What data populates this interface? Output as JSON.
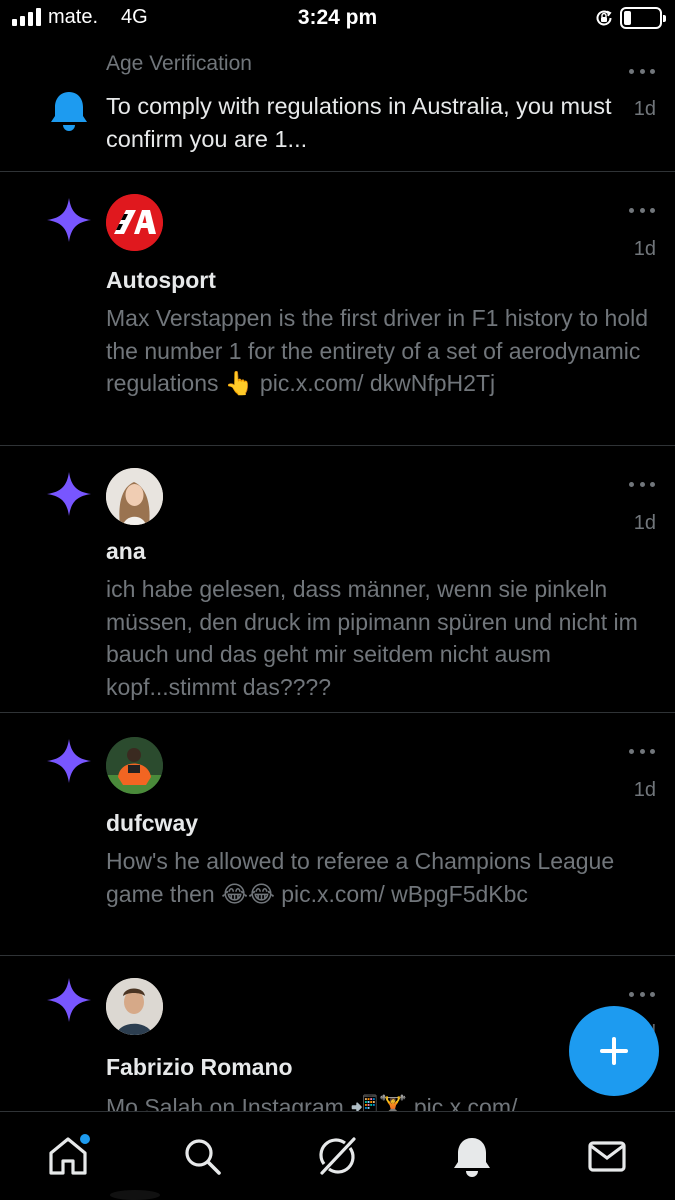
{
  "status_bar": {
    "carrier": "mate.",
    "network": "4G",
    "time": "3:24 pm",
    "battery_level": 0.2
  },
  "notifications": [
    {
      "type": "system",
      "label": "Age Verification",
      "text": "To comply with regulations in Australia, you must confirm you are 1...",
      "time": "1d",
      "icon": "bell-icon"
    },
    {
      "type": "recommended",
      "name": "Autosport",
      "text": "Max Verstappen is the first driver in F1 history to hold the number 1 for the entirety of a set of aerodynamic regulations 👆 pic.x.com/ dkwNfpH2Tj",
      "time": "1d",
      "icon": "sparkle-icon"
    },
    {
      "type": "recommended",
      "name": "ana",
      "text": "ich habe gelesen, dass männer, wenn sie pinkeln müssen, den druck im pipimann spüren und nicht im bauch und das geht mir seitdem nicht ausm kopf...stimmt das????",
      "time": "1d",
      "icon": "sparkle-icon"
    },
    {
      "type": "recommended",
      "name": "dufcway",
      "text": "How's he allowed to referee a Champions League game then 😂😂 pic.x.com/ wBpgF5dKbc",
      "time": "1d",
      "icon": "sparkle-icon"
    },
    {
      "type": "recommended",
      "name": "Fabrizio Romano",
      "text": "Mo Salah on Instagram 📲🏋️ pic.x.com/",
      "time": "1d",
      "icon": "sparkle-icon"
    }
  ],
  "nav": {
    "items": [
      {
        "icon": "home-icon",
        "has_badge": true
      },
      {
        "icon": "search-icon"
      },
      {
        "icon": "grok-icon"
      },
      {
        "icon": "notifications-bell-icon"
      },
      {
        "icon": "messages-icon"
      }
    ]
  },
  "fab": {
    "icon": "plus-icon"
  },
  "colors": {
    "background": "#000000",
    "accent": "#1d9bf0",
    "sparkle": "#7856ff",
    "muted": "#71767b",
    "divider": "#2f3336"
  }
}
